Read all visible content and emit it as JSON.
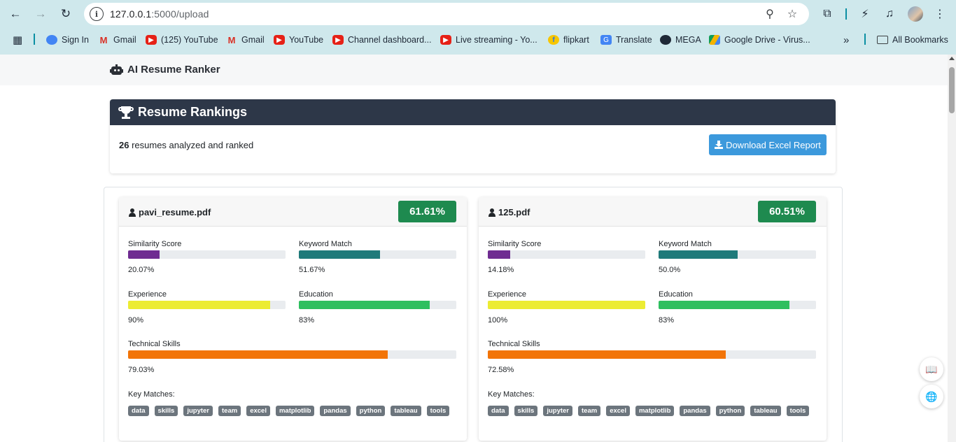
{
  "browser": {
    "url_host": "127.0.0.1",
    "url_rest": ":5000/upload",
    "bookmarks": [
      {
        "label": "Sign In",
        "icon": "signin-icon"
      },
      {
        "label": "Gmail",
        "icon": "gmail-icon"
      },
      {
        "label": "(125) YouTube",
        "icon": "youtube-icon"
      },
      {
        "label": "Gmail",
        "icon": "gmail-icon"
      },
      {
        "label": "YouTube",
        "icon": "youtube-icon"
      },
      {
        "label": "Channel dashboard...",
        "icon": "youtube-icon"
      },
      {
        "label": "Live streaming - Yo...",
        "icon": "youtube-icon"
      },
      {
        "label": "flipkart",
        "icon": "flipkart-icon"
      },
      {
        "label": "Translate",
        "icon": "translate-icon"
      },
      {
        "label": "MEGA",
        "icon": "mega-icon"
      },
      {
        "label": "Google Drive - Virus...",
        "icon": "drive-icon"
      }
    ],
    "all_bookmarks": "All Bookmarks",
    "overflow": "»"
  },
  "app": {
    "brand": "AI Resume Ranker"
  },
  "rankings": {
    "title": "Resume Rankings",
    "count": "26",
    "summary_text": " resumes analyzed and ranked",
    "download_label": "Download Excel Report"
  },
  "labels": {
    "similarity": "Similarity Score",
    "keyword": "Keyword Match",
    "experience": "Experience",
    "education": "Education",
    "technical": "Technical Skills",
    "key_matches": "Key Matches:"
  },
  "colors": {
    "similarity": "#6f2c91",
    "keyword": "#1f7a7a",
    "experience": "#ecec33",
    "education": "#2fbf5f",
    "technical": "#f27407",
    "badge": "#1e8a4f",
    "header": "#2d3748",
    "button": "#3c99dc"
  },
  "resumes": [
    {
      "name": "pavi_resume.pdf",
      "score": "61.61%",
      "similarity": {
        "value": 20.07,
        "text": "20.07%"
      },
      "keyword": {
        "value": 51.67,
        "text": "51.67%"
      },
      "experience": {
        "value": 90,
        "text": "90%"
      },
      "education": {
        "value": 83,
        "text": "83%"
      },
      "technical": {
        "value": 79.03,
        "text": "79.03%"
      },
      "matches": [
        "data",
        "skills",
        "jupyter",
        "team",
        "excel",
        "matplotlib",
        "pandas",
        "python",
        "tableau",
        "tools"
      ]
    },
    {
      "name": "125.pdf",
      "score": "60.51%",
      "similarity": {
        "value": 14.18,
        "text": "14.18%"
      },
      "keyword": {
        "value": 50.0,
        "text": "50.0%"
      },
      "experience": {
        "value": 100,
        "text": "100%"
      },
      "education": {
        "value": 83,
        "text": "83%"
      },
      "technical": {
        "value": 72.58,
        "text": "72.58%"
      },
      "matches": [
        "data",
        "skills",
        "jupyter",
        "team",
        "excel",
        "matplotlib",
        "pandas",
        "python",
        "tableau",
        "tools"
      ]
    }
  ]
}
